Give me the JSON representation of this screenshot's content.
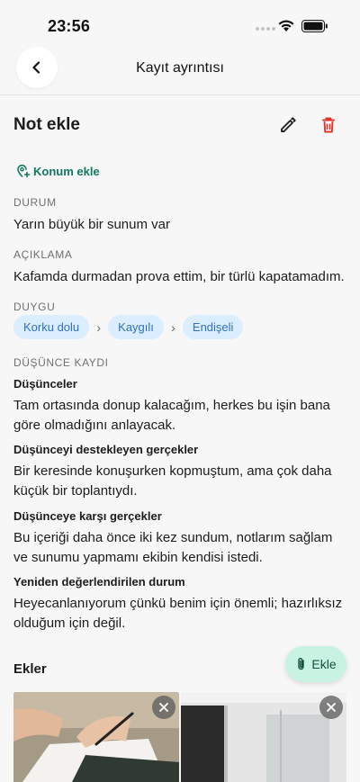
{
  "status_bar": {
    "time": "23:56"
  },
  "nav": {
    "title": "Kayıt ayrıntısı"
  },
  "note": {
    "title": "Not ekle"
  },
  "location": {
    "label": "Konum ekle"
  },
  "situation": {
    "label": "DURUM",
    "text": "Yarın büyük bir sunum var"
  },
  "description": {
    "label": "AÇIKLAMA",
    "text": "Kafamda durmadan prova ettim, bir türlü kapatamadım."
  },
  "emotion": {
    "label": "DUYGU",
    "chips": [
      "Korku dolu",
      "Kaygılı",
      "Endişeli"
    ]
  },
  "thought_record": {
    "label": "DÜŞÜNCE KAYDI",
    "thoughts_title": "Düşünceler",
    "thoughts_text": "Tam ortasında donup kalacağım, herkes bu işin bana göre olmadığını anlayacak.",
    "supporting_title": "Düşünceyi destekleyen gerçekler",
    "supporting_text": "Bir keresinde konuşurken kopmuştum, ama çok daha küçük bir toplantıydı.",
    "against_title": "Düşünceye karşı gerçekler",
    "against_text": "Bu içeriği daha önce iki kez sundum, notlarım sağlam ve sunumu yapmamı ekibin kendisi istedi.",
    "reassessed_title": "Yeniden değerlendirilen durum",
    "reassessed_text": "Heyecanlanıyorum çünkü benim için önemli; hazırlıksız olduğum için değil."
  },
  "attachments": {
    "title": "Ekler",
    "add_label": "Ekle"
  },
  "colors": {
    "accent_green": "#0f7a5f",
    "delete_red": "#e0342a",
    "chip_bg": "#dbeeff",
    "chip_text": "#2f6fbd",
    "fab_bg": "#c8f2e2"
  }
}
